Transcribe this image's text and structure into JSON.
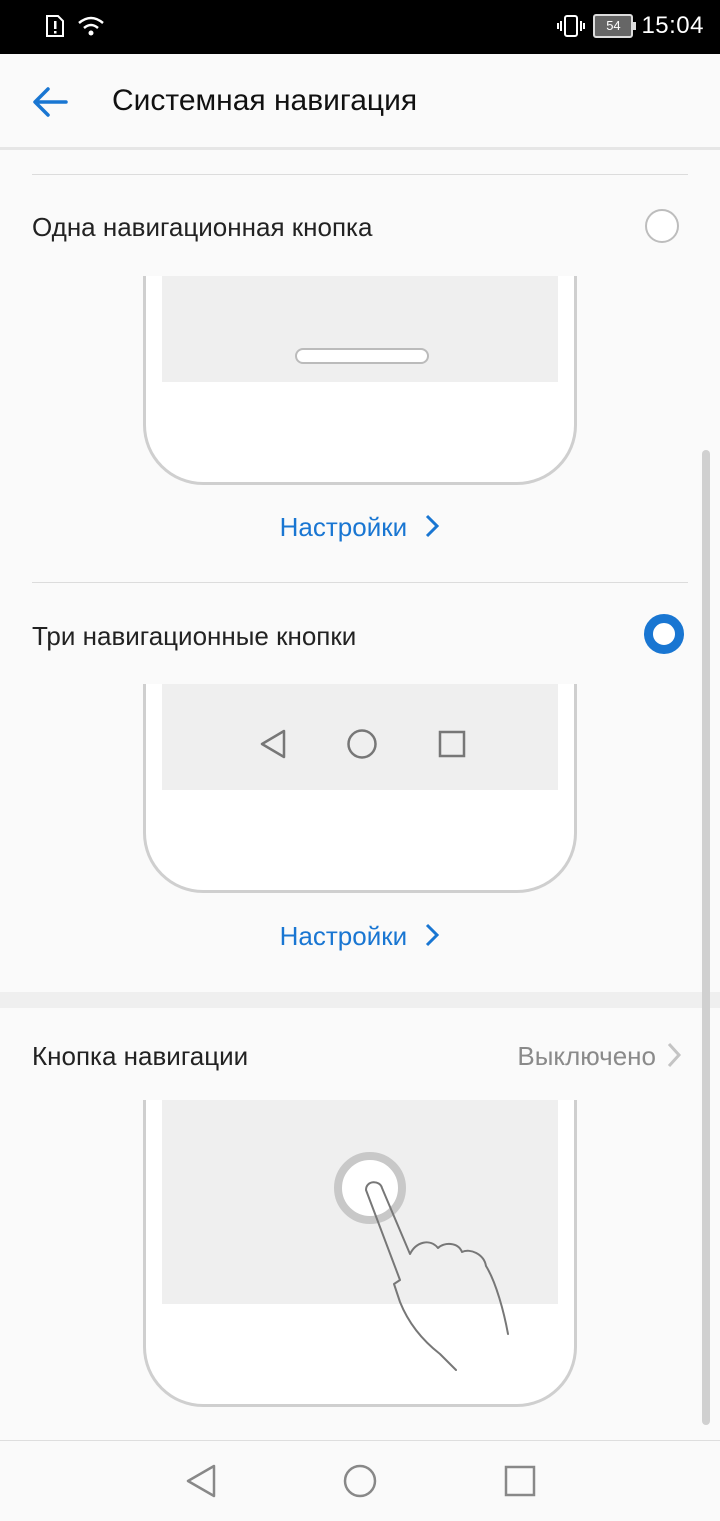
{
  "status_bar": {
    "time": "15:04",
    "battery": "54",
    "icons": [
      "sim-alert-icon",
      "wifi-icon",
      "vibrate-icon",
      "battery-icon"
    ]
  },
  "header": {
    "title": "Системная навигация",
    "back_icon": "arrow-left-icon"
  },
  "options": [
    {
      "label": "Одна навигационная кнопка",
      "selected": false,
      "settings_link": "Настройки"
    },
    {
      "label": "Три навигационные кнопки",
      "selected": true,
      "settings_link": "Настройки"
    }
  ],
  "nav_button": {
    "label": "Кнопка навигации",
    "value": "Выключено"
  },
  "colors": {
    "accent": "#1976d2",
    "muted": "#8a8a8a"
  },
  "system_nav": [
    "back-icon",
    "home-icon",
    "recents-icon"
  ]
}
